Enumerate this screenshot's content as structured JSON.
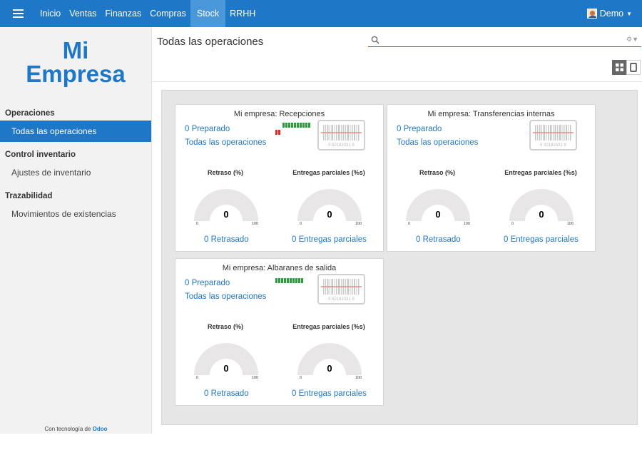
{
  "navbar": {
    "menu": [
      "Inicio",
      "Ventas",
      "Finanzas",
      "Compras",
      "Stock",
      "RRHH"
    ],
    "active": "Stock",
    "user": "Demo"
  },
  "sidebar": {
    "logo_line1": "Mi",
    "logo_line2": "Empresa",
    "sections": [
      {
        "header": "Operaciones",
        "items": [
          "Todas las operaciones"
        ]
      },
      {
        "header": "Control inventario",
        "items": [
          "Ajustes de inventario"
        ]
      },
      {
        "header": "Trazabilidad",
        "items": [
          "Movimientos de existencias"
        ]
      }
    ],
    "active_item": "Todas las operaciones",
    "powered_prefix": "Con tecnología de",
    "powered_brand": "Odoo"
  },
  "control_panel": {
    "title": "Todas las operaciones",
    "search": {
      "value": "",
      "placeholder": ""
    }
  },
  "cards": [
    {
      "title": "Mi empresa: Recepciones",
      "ready": "0 Preparado",
      "all_ops": "Todas las operaciones",
      "delay_label": "Retraso (%)",
      "partial_label": "Entregas parciales (%s)",
      "delay_value": "0",
      "partial_value": "0",
      "gauge_min": "0",
      "gauge_max": "100",
      "delay_link": "0 Retrasado",
      "partial_link": "0 Entregas parciales",
      "bars_red": 2,
      "bars_green": 10,
      "barcode_text": "5 92182431 8"
    },
    {
      "title": "Mi empresa: Transferencias internas",
      "ready": "0 Preparado",
      "all_ops": "Todas las operaciones",
      "delay_label": "Retraso (%)",
      "partial_label": "Entregas parciales (%s)",
      "delay_value": "0",
      "partial_value": "0",
      "gauge_min": "0",
      "gauge_max": "100",
      "delay_link": "0 Retrasado",
      "partial_link": "0 Entregas parciales",
      "bars_red": 0,
      "bars_green": 0,
      "barcode_text": "5 92182431 8"
    },
    {
      "title": "Mi empresa: Albaranes de salida",
      "ready": "0 Preparado",
      "all_ops": "Todas las operaciones",
      "delay_label": "Retraso (%)",
      "partial_label": "Entregas parciales (%s)",
      "delay_value": "0",
      "partial_value": "0",
      "gauge_min": "0",
      "gauge_max": "100",
      "delay_link": "0 Retrasado",
      "partial_link": "0 Entregas parciales",
      "bars_red": 0,
      "bars_green": 10,
      "barcode_text": "5 92182431 8"
    }
  ],
  "colors": {
    "brand": "#1f78c7",
    "bar_green": "#2e9b3f",
    "bar_red": "#d9302c",
    "gauge_track": "#e8e6e6"
  },
  "icons": {
    "menu": "hamburger-icon",
    "search": "search-icon",
    "kanban_view": "kanban-view-icon",
    "list_view": "list-view-icon",
    "barcode": "barcode-icon"
  }
}
